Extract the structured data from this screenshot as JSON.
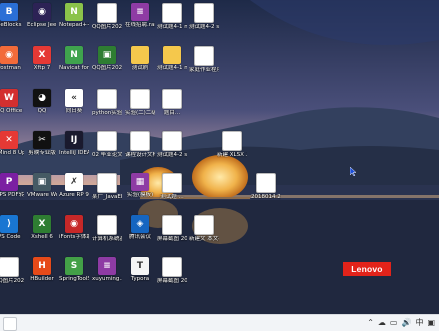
{
  "desktop": {
    "icons": [
      {
        "label": "BeBlocks",
        "kind": "exe",
        "glyph": "B",
        "color": "#2b6fd6"
      },
      {
        "label": "Eclipse Jee 2019-03",
        "kind": "exe",
        "glyph": "◉",
        "color": "#2c2255"
      },
      {
        "label": "Notepad++",
        "kind": "exe",
        "glyph": "N",
        "color": "#8bc34a"
      },
      {
        "label": "QQ图片20220329...",
        "kind": "doc",
        "glyph": "▦",
        "color": "#ffffff"
      },
      {
        "label": "在线招聘.rar",
        "kind": "exe",
        "glyph": "≡",
        "color": "#8e3ba4"
      },
      {
        "label": "测试题4-1 mybatis...",
        "kind": "doc",
        "glyph": "W",
        "color": "#ffffff"
      },
      {
        "label": "测试题4-2 spring.(0...",
        "kind": "doc",
        "glyph": "W",
        "color": "#ffffff"
      },
      {
        "label": "Postman",
        "kind": "exe",
        "glyph": "◉",
        "color": "#f26b3a"
      },
      {
        "label": "Xftp 7",
        "kind": "exe",
        "glyph": "X",
        "color": "#e53935"
      },
      {
        "label": "Navicat for MySQL",
        "kind": "exe",
        "glyph": "N",
        "color": "#3fa34d"
      },
      {
        "label": "QQ图片20220329...",
        "kind": "exe",
        "glyph": "▣",
        "color": "#2e7d32"
      },
      {
        "label": "测试刷",
        "kind": "folder",
        "glyph": "",
        "color": "#f5c84c"
      },
      {
        "label": "测试题4-1 mybatis...",
        "kind": "folder",
        "glyph": "",
        "color": "#f5c84c"
      },
      {
        "label": "家庭作业程序设计...",
        "kind": "doc",
        "glyph": "P",
        "color": "#ffffff"
      },
      {
        "label": "QQ Office",
        "kind": "exe",
        "glyph": "W",
        "color": "#d32f2f"
      },
      {
        "label": "QQ",
        "kind": "exe",
        "glyph": "◕",
        "color": "#111111"
      },
      {
        "label": "向日葵",
        "kind": "exe",
        "glyph": "«",
        "color": "#ffffff"
      },
      {
        "label": "python实验(项目 2020...",
        "kind": "doc",
        "glyph": "W",
        "color": "#ffffff"
      },
      {
        "label": "实验(二)二级信...",
        "kind": "doc",
        "glyph": "W",
        "color": "#ffffff"
      },
      {
        "label": "题目...",
        "kind": "doc",
        "glyph": "≣",
        "color": "#ffffff"
      },
      {
        "label": "XMind 8 Update 7",
        "kind": "exe",
        "glyph": "✕",
        "color": "#e53935"
      },
      {
        "label": "剪映专业版",
        "kind": "exe",
        "glyph": "✂",
        "color": "#111111"
      },
      {
        "label": "IntelliJ IDEA 2019",
        "kind": "exe",
        "glyph": "IJ",
        "color": "#1a1a2e"
      },
      {
        "label": "02 毕业论文——华...",
        "kind": "doc",
        "glyph": "W",
        "color": "#ffffff"
      },
      {
        "label": "课程设计文档——模板...",
        "kind": "doc",
        "glyph": "W",
        "color": "#ffffff"
      },
      {
        "label": "测试题4-2 spring",
        "kind": "doc",
        "glyph": "W",
        "color": "#ffffff"
      },
      {
        "label": "新建 XLSX 工作表.xlsx",
        "kind": "doc",
        "glyph": "X",
        "color": "#ffffff"
      },
      {
        "label": "WPS PDF转Word",
        "kind": "exe",
        "glyph": "P",
        "color": "#7b1fa2"
      },
      {
        "label": "VMware Workstat...",
        "kind": "exe",
        "glyph": "▣",
        "color": "#455a64"
      },
      {
        "label": "Azure RP 9",
        "kind": "exe",
        "glyph": "✗",
        "color": "#ffffff"
      },
      {
        "label": "某广_JavaEE 程序设...",
        "kind": "doc",
        "glyph": "W",
        "color": "#ffffff"
      },
      {
        "label": "实验(模板)",
        "kind": "exe",
        "glyph": "▦",
        "color": "#8e3ba4"
      },
      {
        "label": "测试题 ...",
        "kind": "doc",
        "glyph": "W",
        "color": "#ffffff"
      },
      {
        "label": "2018014 2 ...(ixxx",
        "kind": "doc",
        "glyph": "W",
        "color": "#ffffff"
      },
      {
        "label": "VS Code",
        "kind": "exe",
        "glyph": "⟩",
        "color": "#1976d2"
      },
      {
        "label": "Xshell 6",
        "kind": "exe",
        "glyph": "X",
        "color": "#2e7d32"
      },
      {
        "label": "iFonts字体助手",
        "kind": "exe",
        "glyph": "◉",
        "color": "#c62828"
      },
      {
        "label": "计算机系统基础实验...",
        "kind": "doc",
        "glyph": "W",
        "color": "#ffffff"
      },
      {
        "label": "腾讯会议",
        "kind": "exe",
        "glyph": "◈",
        "color": "#1565c0"
      },
      {
        "label": "屏幕截图 2022-03-...",
        "kind": "doc",
        "glyph": "▦",
        "color": "#ffffff"
      },
      {
        "label": "新建文 本文档 ...",
        "kind": "doc",
        "glyph": "W",
        "color": "#ffffff"
      },
      {
        "label": "QQ图片202003...",
        "kind": "doc",
        "glyph": "▦",
        "color": "#ffffff"
      },
      {
        "label": "HBuilder",
        "kind": "exe",
        "glyph": "H",
        "color": "#e64a19"
      },
      {
        "label": "SpringToolSuite4",
        "kind": "exe",
        "glyph": "S",
        "color": "#43a047"
      },
      {
        "label": "xuyuming...",
        "kind": "exe",
        "glyph": "≡",
        "color": "#8e3ba4"
      },
      {
        "label": "Typora",
        "kind": "exe",
        "glyph": "T",
        "color": "#f5f5f5"
      },
      {
        "label": "屏幕截图 2022-04-1...",
        "kind": "doc",
        "glyph": "▦",
        "color": "#ffffff"
      }
    ]
  },
  "brand": {
    "label": "Lenovo",
    "color": "#e2231a"
  },
  "taskbar": {
    "tray": [
      "⌃",
      "☁",
      "▭",
      "🔊",
      "中",
      "▣"
    ]
  }
}
